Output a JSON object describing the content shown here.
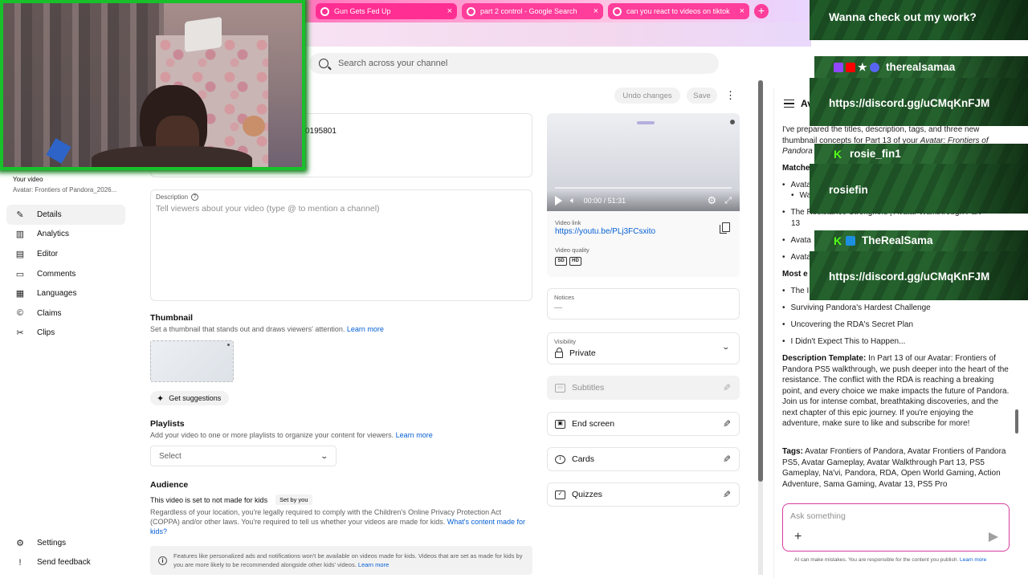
{
  "browser": {
    "tabs": [
      {
        "label": "Gun Gets Fed Up",
        "close": "×"
      },
      {
        "label": "part 2 control - Google Search",
        "close": "×"
      },
      {
        "label": "can you react to videos on tiktok",
        "close": "×"
      }
    ],
    "new_tab": "+"
  },
  "search": {
    "placeholder": "Search across your channel"
  },
  "toolbar": {
    "undo": "Undo changes",
    "save": "Save",
    "more": "⋮"
  },
  "sidebar": {
    "your_video_label": "Your video",
    "video_title": "Avatar: Frontiers of Pandora_2026...",
    "items": [
      {
        "label": "Details",
        "icon": "pencil-icon",
        "glyph": "✎",
        "active": true
      },
      {
        "label": "Analytics",
        "icon": "analytics-icon",
        "glyph": "▥"
      },
      {
        "label": "Editor",
        "icon": "editor-icon",
        "glyph": "▤"
      },
      {
        "label": "Comments",
        "icon": "comments-icon",
        "glyph": "▭"
      },
      {
        "label": "Languages",
        "icon": "languages-icon",
        "glyph": "▦"
      },
      {
        "label": "Claims",
        "icon": "claims-icon",
        "glyph": "©"
      },
      {
        "label": "Clips",
        "icon": "scissors-icon",
        "glyph": "✂"
      }
    ],
    "bottom": [
      {
        "label": "Settings",
        "icon": "gear-icon",
        "glyph": "⚙"
      },
      {
        "label": "Send feedback",
        "icon": "feedback-icon",
        "glyph": "!"
      }
    ]
  },
  "details": {
    "title_fragment": "0195801",
    "description_label": "Description",
    "description_help": "?",
    "description_placeholder": "Tell viewers about your video (type @ to mention a channel)",
    "thumbnail": {
      "heading": "Thumbnail",
      "text": "Set a thumbnail that stands out and draws viewers' attention.",
      "link": "Learn more",
      "suggest_button": "Get suggestions"
    },
    "playlists": {
      "heading": "Playlists",
      "text": "Add your video to one or more playlists to organize your content for viewers.",
      "link": "Learn more",
      "select_value": "Select"
    },
    "audience": {
      "heading": "Audience",
      "status": "This video is set to not made for kids",
      "chip": "Set by you",
      "text": "Regardless of your location, you're legally required to comply with the Children's Online Privacy Protection Act (COPPA) and/or other laws. You're required to tell us whether your videos are made for kids.",
      "link": "What's content made for kids?",
      "notice": "Features like personalized ads and notifications won't be available on videos made for kids. Videos that are set as made for kids by you are more likely to be recommended alongside other kids' videos.",
      "notice_link": "Learn more"
    }
  },
  "player": {
    "time": "00:00 / 51:31",
    "video_link_label": "Video link",
    "video_link": "https://youtu.be/PLj3FCsxito",
    "quality_label": "Video quality",
    "quality_badges": [
      "SD",
      "HD"
    ]
  },
  "right_panel": {
    "notices_label": "Notices",
    "notices_value": "—",
    "visibility_label": "Visibility",
    "visibility_value": "Private",
    "rows": [
      {
        "label": "Subtitles",
        "icon": "subtitles-icon",
        "disabled": true
      },
      {
        "label": "End screen",
        "icon": "end-screen-icon",
        "disabled": false
      },
      {
        "label": "Cards",
        "icon": "cards-icon",
        "disabled": false
      },
      {
        "label": "Quizzes",
        "icon": "quizzes-icon",
        "disabled": false
      }
    ]
  },
  "ai": {
    "title": "Av",
    "intro_before": "I've prepared the titles, description, tags, and three new thumbnail concepts for Part 13 of your ",
    "intro_italic": "Avatar: Frontiers of",
    "intro_italic2": "Pandora",
    "matches_heading": "Matche",
    "matches": [
      "Avata",
      "Walk",
      "The Resistance Stronghold | Avatar Walkthrough Part",
      "13",
      "Avata",
      "Avata"
    ],
    "most_heading": "Most e",
    "most": [
      "The I",
      "Surviving Pandora's Hardest Challenge",
      "Uncovering the RDA's Secret Plan",
      "I Didn't Expect This to Happen..."
    ],
    "description_heading": "Description Template:",
    "description_text": "In Part 13 of our Avatar: Frontiers of Pandora PS5 walkthrough, we push deeper into the heart of the resistance. The conflict with the RDA is reaching a breaking point, and every choice we make impacts the future of Pandora. Join us for intense combat, breathtaking discoveries, and the next chapter of this epic journey. If you're enjoying the adventure, make sure to like and subscribe for more!",
    "tags_heading": "Tags:",
    "tags_text": "Avatar Frontiers of Pandora, Avatar Frontiers of Pandora PS5, Avatar Gameplay, Avatar Walkthrough Part 13, PS5 Gameplay, Na'vi, Pandora, RDA, Open World Gaming, Action Adventure, Sama Gaming, Avatar 13, PS5 Pro",
    "ask_placeholder": "Ask something",
    "ask_plus": "+",
    "disclaimer": "AI can make mistakes. You are responsible for the content you publish.",
    "disclaimer_link": "Learn more"
  },
  "overlay": {
    "cta": "Wanna check out my work?",
    "handle1": "therealsamaa",
    "discord1": "https://discord.gg/uCMqKnFJM",
    "handle2": "rosie_fin1",
    "handle2b": "rosiefin",
    "handle3": "TheRealSama",
    "discord2": "https://discord.gg/uCMqKnFJM"
  },
  "colors": {
    "accent_link": "#065fd4",
    "overlay_green": "#2b6b33",
    "webcam_border": "#18c02a",
    "tab_pink": "#ff4fa8"
  }
}
